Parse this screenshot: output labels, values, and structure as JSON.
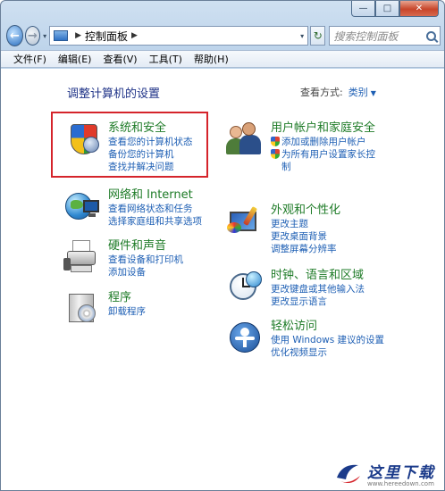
{
  "window": {
    "caption_buttons": {
      "minimize": "—",
      "maximize": "□",
      "close": "✕"
    }
  },
  "nav": {
    "back_icon": "←",
    "forward_icon": "→",
    "dropdown_icon": "▾",
    "address_separator": "▶",
    "address_path": "控制面板",
    "address_trailing": "▶",
    "refresh_icon": "↻",
    "search_placeholder": "搜索控制面板"
  },
  "menu": {
    "items": [
      "文件(F)",
      "编辑(E)",
      "查看(V)",
      "工具(T)",
      "帮助(H)"
    ]
  },
  "main": {
    "title": "调整计算机的设置",
    "view_by_label": "查看方式:",
    "view_by_value": "类别",
    "view_by_caret": "▼"
  },
  "categories": {
    "system_security": {
      "title": "系统和安全",
      "links": [
        "查看您的计算机状态",
        "备份您的计算机",
        "查找并解决问题"
      ],
      "icon": "shield-icon"
    },
    "user_accounts": {
      "title": "用户帐户和家庭安全",
      "links": [
        "添加或删除用户帐户",
        "为所有用户设置家长控制"
      ],
      "icon": "users-icon"
    },
    "network": {
      "title": "网络和 Internet",
      "links": [
        "查看网络状态和任务",
        "选择家庭组和共享选项"
      ],
      "icon": "network-icon"
    },
    "appearance": {
      "title": "外观和个性化",
      "links": [
        "更改主题",
        "更改桌面背景",
        "调整屏幕分辨率"
      ],
      "icon": "appearance-icon"
    },
    "hardware": {
      "title": "硬件和声音",
      "links": [
        "查看设备和打印机",
        "添加设备"
      ],
      "icon": "printer-icon"
    },
    "clock": {
      "title": "时钟、语言和区域",
      "links": [
        "更改键盘或其他输入法",
        "更改显示语言"
      ],
      "icon": "clock-icon"
    },
    "programs": {
      "title": "程序",
      "links": [
        "卸载程序"
      ],
      "icon": "programs-icon"
    },
    "ease": {
      "title": "轻松访问",
      "links": [
        "使用 Windows 建议的设置",
        "优化视频显示"
      ],
      "icon": "ease-of-access-icon"
    }
  },
  "colors": {
    "category_title": "#1e7b27",
    "link": "#1e5fb4",
    "highlight_border": "#d5242b"
  },
  "watermark": {
    "text": "这里下载",
    "url": "www.hereedown.com"
  }
}
